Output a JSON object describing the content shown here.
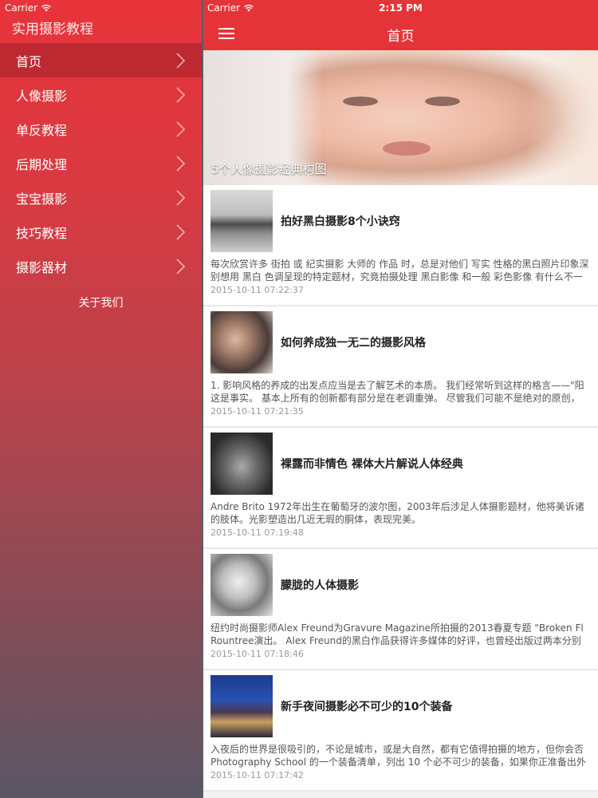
{
  "sidebar": {
    "carrier": "Carrier",
    "title": "实用摄影教程",
    "items": [
      {
        "label": "首页"
      },
      {
        "label": "人像摄影"
      },
      {
        "label": "单反教程"
      },
      {
        "label": "后期处理"
      },
      {
        "label": "宝宝摄影"
      },
      {
        "label": "技巧教程"
      },
      {
        "label": "摄影器材"
      }
    ],
    "about": "关于我们"
  },
  "main": {
    "carrier": "Carrier",
    "time": "2:15 PM",
    "title": "首页",
    "hero_caption": "5个人像摄影经典构图",
    "articles": [
      {
        "title": "拍好黑白摄影8个小诀窍",
        "summary1": "每次欣赏许多 街拍 或 纪实摄影 大师的 作品 时，总是对他们 写实 性格的黑白照片印象深",
        "summary2": "别想用 黑白 色调呈现的特定题材，究竟拍摄处理 黑白影像 和一般 彩色影像 有什么不一",
        "date": "2015-10-11 07:22:37"
      },
      {
        "title": "如何养成独一无二的摄影风格",
        "summary1": "1. 影响风格的养成的出发点应当是去了解艺术的本质。 我们经常听到这样的格言——\"阳",
        "summary2": "这是事实。 基本上所有的创新都有部分是在老调重弹。 尽管我们可能不是绝对的原创，",
        "date": "2015-10-11 07:21:35"
      },
      {
        "title": "裸露而非情色 裸体大片解说人体经典",
        "summary1": "Andre Brito 1972年出生在葡萄牙的波尔图，2003年后涉足人体摄影题材，他将美诉诸",
        "summary2": "的肢体。光影塑造出几近无瑕的胴体，表现完美。",
        "date": "2015-10-11 07:19:48"
      },
      {
        "title": "朦胧的人体摄影",
        "summary1": "纽约时尚摄影师Alex Freund为Gravure Magazine所拍摄的2013春夏专题 \"Broken Fl",
        "summary2": "Rountree演出。 Alex Freund的黑白作品获得许多媒体的好评，也曾经出版过两本分别",
        "date": "2015-10-11 07:18:46"
      },
      {
        "title": "新手夜间摄影必不可少的10个装备",
        "summary1": "入夜后的世界是很吸引的，不论是城市，或是大自然，都有它值得拍摄的地方，但你会否",
        "summary2": "Photography School 的一个装备清单，列出 10 个必不可少的装备，如果你正准备出外",
        "date": "2015-10-11 07:17:42"
      }
    ]
  }
}
